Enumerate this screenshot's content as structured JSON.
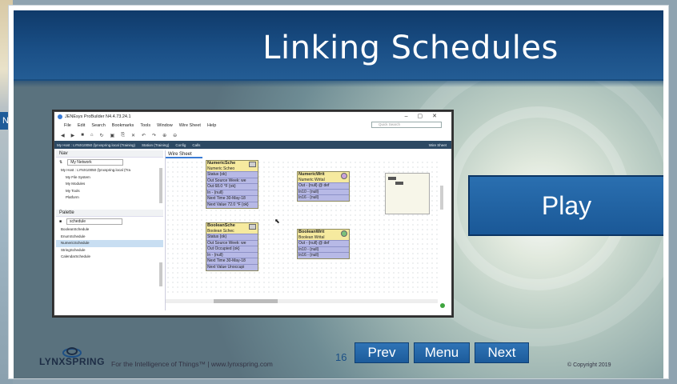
{
  "slide": {
    "title": "Linking Schedules",
    "play_label": "Play",
    "page_number": "16",
    "nav": {
      "prev": "Prev",
      "menu": "Menu",
      "next": "Next"
    },
    "footer": {
      "brand": "LYNXSPRING",
      "tagline": "For the Intelligence of Things™ | www.lynxspring.com",
      "copyright": "© Copyright 2019"
    }
  },
  "desktop": {
    "tab_label": "N"
  },
  "app": {
    "window_title": "JENEsys ProBuilder N4.4.73.24.1",
    "menu": [
      "File",
      "Edit",
      "Search",
      "Bookmarks",
      "Tools",
      "Window",
      "Wire Sheet",
      "Help"
    ],
    "quick_search_placeholder": "Quick Search",
    "path": [
      "My Host : LYNX10050 (lynxspring.local (Training)",
      "Station (Training)",
      "Config",
      "Calls"
    ],
    "path_right": "Wire Sheet",
    "nav": {
      "title": "Nav",
      "selector": "My Network",
      "items": [
        "My Host : LYNX10050 (lynxspring.local (Tra",
        "My File System",
        "My Modules",
        "My Tools",
        "Platform"
      ]
    },
    "palette": {
      "title": "Palette",
      "selector": "schedule",
      "items": [
        "BooleanSchedule",
        "EnumSchedule",
        "NumericSchedule",
        "StringSchedule",
        "CalendarSchedule"
      ],
      "selected_index": 2
    },
    "wire_tab": "Wire Sheet",
    "blocks": [
      {
        "name": "NumericSche",
        "type": "Numeric Scheo",
        "rows": [
          "Status {ok}",
          "Out Source Week: we",
          "Out 68.0 °F {ok}",
          "In - {null}",
          "Next Time 30-May-18",
          "Next Value 72.0 °F {ok}"
        ]
      },
      {
        "name": "NumericWrit",
        "type": "Numeric Writal",
        "rows": [
          "Out - {null} @ def",
          "In10 - {null}",
          "In16 - {null}"
        ]
      },
      {
        "name": "BooleanSche",
        "type": "Boolean Schec",
        "rows": [
          "Status {ok}",
          "Out Source Week: we",
          "Out Occupied {ok}",
          "In - {null}",
          "Next Time 30-May-18",
          "Next Value Unoccupi"
        ]
      },
      {
        "name": "BooleanWrit",
        "type": "Boolean Writal",
        "rows": [
          "Out - {null} @ def",
          "In10 - {null}",
          "In16 - {null}"
        ]
      }
    ]
  },
  "colors": {
    "header_blue": "#1a4f86",
    "button_blue": "#1f64a6",
    "block_yellow": "#f6ea9f",
    "block_row_purple": "#b7b9e6"
  }
}
